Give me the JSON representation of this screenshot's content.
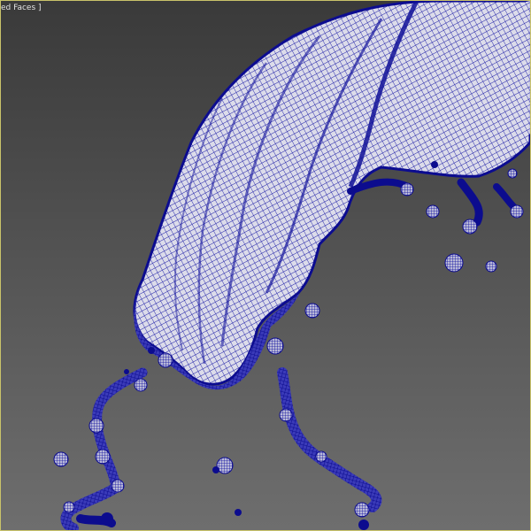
{
  "viewport": {
    "label": "ed Faces ]",
    "background_top_color": "#3a3a3a",
    "background_bottom_color": "#6e6e6e",
    "border_color": "#c9c36a"
  },
  "scene": {
    "object": "liquid-splash-mesh",
    "wire_color": "#1a1aa8",
    "shaded_color": "#d6d6e4",
    "edge_dense_color": "#0a0a8c"
  }
}
